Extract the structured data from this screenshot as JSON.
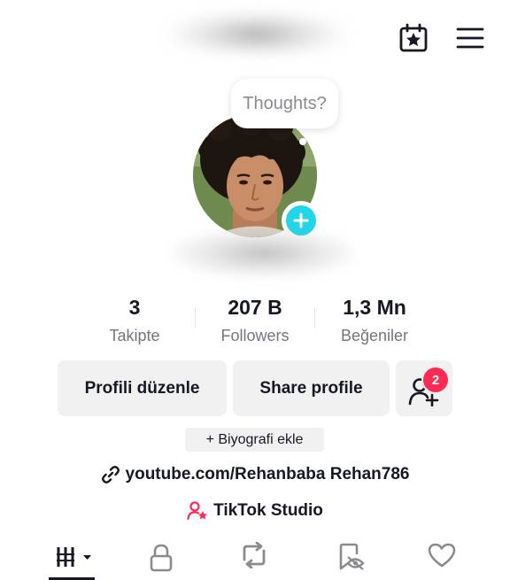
{
  "header": {
    "calendar_icon": "calendar-star-icon",
    "menu_icon": "hamburger-menu-icon"
  },
  "profile": {
    "thought_bubble": "Thoughts?",
    "add_icon": "plus-icon"
  },
  "stats": [
    {
      "value": "3",
      "label": "Takipte"
    },
    {
      "value": "207 B",
      "label": "Followers"
    },
    {
      "value": "1,3 Mn",
      "label": "Beğeniler"
    }
  ],
  "actions": {
    "edit_label": "Profili düzenle",
    "share_label": "Share profile",
    "add_friend_badge": "2"
  },
  "bio": {
    "add_bio_label": "+ Biyografi ekle",
    "link_text": "youtube.com/Rehanbaba Rehan786",
    "studio_label": "TikTok Studio"
  },
  "tabs": [
    {
      "name": "videos-grid",
      "icon": "grid-icon"
    },
    {
      "name": "private",
      "icon": "lock-icon"
    },
    {
      "name": "reposts",
      "icon": "repost-icon"
    },
    {
      "name": "favorites",
      "icon": "bookmark-eye-icon"
    },
    {
      "name": "liked",
      "icon": "heart-icon"
    }
  ],
  "colors": {
    "accent_cyan": "#20d5ec",
    "badge_red": "#fe2c55",
    "button_bg": "#f1f1f2",
    "text_dark": "#161823",
    "text_muted": "#75767d"
  }
}
